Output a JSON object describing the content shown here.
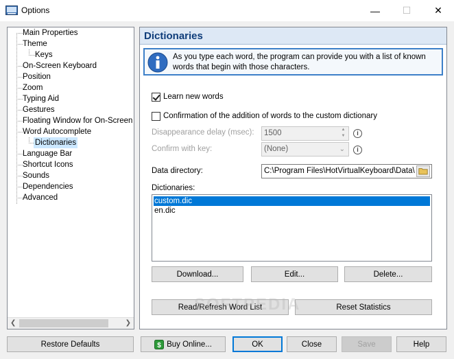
{
  "window": {
    "title": "Options",
    "min_icon": "minimize-icon",
    "max_icon": "maximize-icon",
    "close_icon": "close-icon"
  },
  "tree": {
    "items": [
      {
        "label": "Main Properties"
      },
      {
        "label": "Theme"
      },
      {
        "label": "Keys"
      },
      {
        "label": "On-Screen Keyboard"
      },
      {
        "label": "Position"
      },
      {
        "label": "Zoom"
      },
      {
        "label": "Typing Aid"
      },
      {
        "label": "Gestures"
      },
      {
        "label": "Floating Window for On-Screen Ke"
      },
      {
        "label": "Word Autocomplete"
      },
      {
        "label": "Dictionaries"
      },
      {
        "label": "Language Bar"
      },
      {
        "label": "Shortcut Icons"
      },
      {
        "label": "Sounds"
      },
      {
        "label": "Dependencies"
      },
      {
        "label": "Advanced"
      }
    ],
    "selected": "Dictionaries"
  },
  "panel": {
    "title": "Dictionaries",
    "info": "As you type each word, the program can provide you with a list of known words that begin with those characters.",
    "learn_new_words": {
      "label": "Learn new words",
      "checked": true
    },
    "confirm_addition": {
      "label": "Confirmation of the addition of words to the custom dictionary",
      "checked": false
    },
    "disappearance_delay": {
      "label": "Disappearance delay (msec):",
      "value": "1500"
    },
    "confirm_key": {
      "label": "Confirm with key:",
      "value": "(None)"
    },
    "data_directory": {
      "label": "Data directory:",
      "value": "C:\\Program Files\\HotVirtualKeyboard\\Data\\"
    },
    "dictionaries_label": "Dictionaries:",
    "dictionaries": [
      "custom.dic",
      "en.dic"
    ],
    "selected_dictionary": "custom.dic",
    "buttons": {
      "download": "Download...",
      "edit": "Edit...",
      "delete": "Delete...",
      "refresh": "Read/Refresh Word List",
      "reset": "Reset Statistics"
    }
  },
  "footer": {
    "restore": "Restore Defaults",
    "buy": "Buy Online...",
    "ok": "OK",
    "close": "Close",
    "save": "Save",
    "help": "Help"
  },
  "watermark": "SOFTPEDIA"
}
